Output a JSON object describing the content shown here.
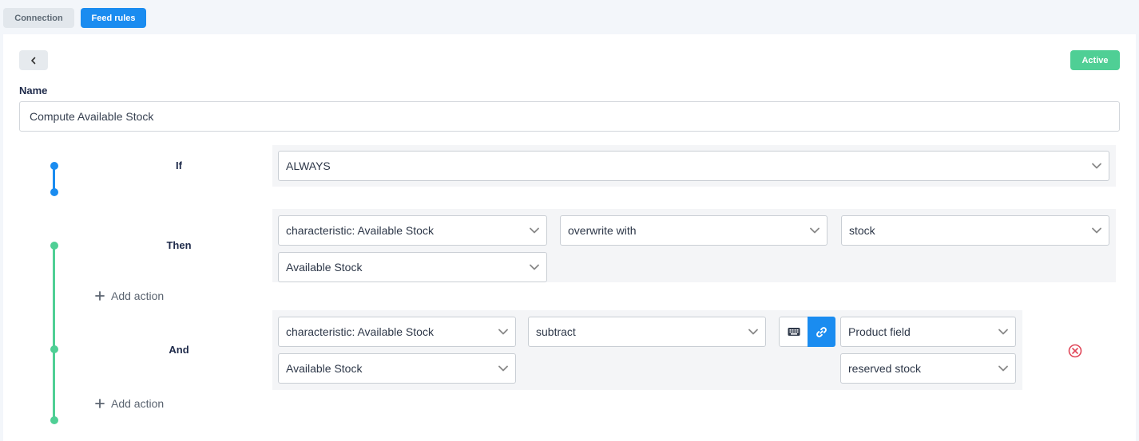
{
  "tabs": {
    "connection": "Connection",
    "feed_rules": "Feed rules"
  },
  "status_badge": "Active",
  "name": {
    "label": "Name",
    "value": "Compute Available Stock"
  },
  "conditions": {
    "if_label": "If",
    "then_label": "Then",
    "and_label": "And",
    "if_value": "ALWAYS"
  },
  "then_action": {
    "field": "characteristic: Available Stock",
    "operation": "overwrite with",
    "source": "stock",
    "target": "Available Stock"
  },
  "and_action": {
    "field": "characteristic: Available Stock",
    "operation": "subtract",
    "source_type": "Product field",
    "target": "Available Stock",
    "source_field": "reserved stock"
  },
  "add_action_label": "Add action",
  "icons": {
    "back": "chevron-left-icon",
    "dropdown": "chevron-down-icon",
    "keyboard": "keyboard-icon",
    "link": "link-icon",
    "remove": "circle-x-icon",
    "add": "plus-icon"
  },
  "colors": {
    "primary": "#1a8cf0",
    "success": "#4fcf95",
    "danger": "#e0485a"
  }
}
